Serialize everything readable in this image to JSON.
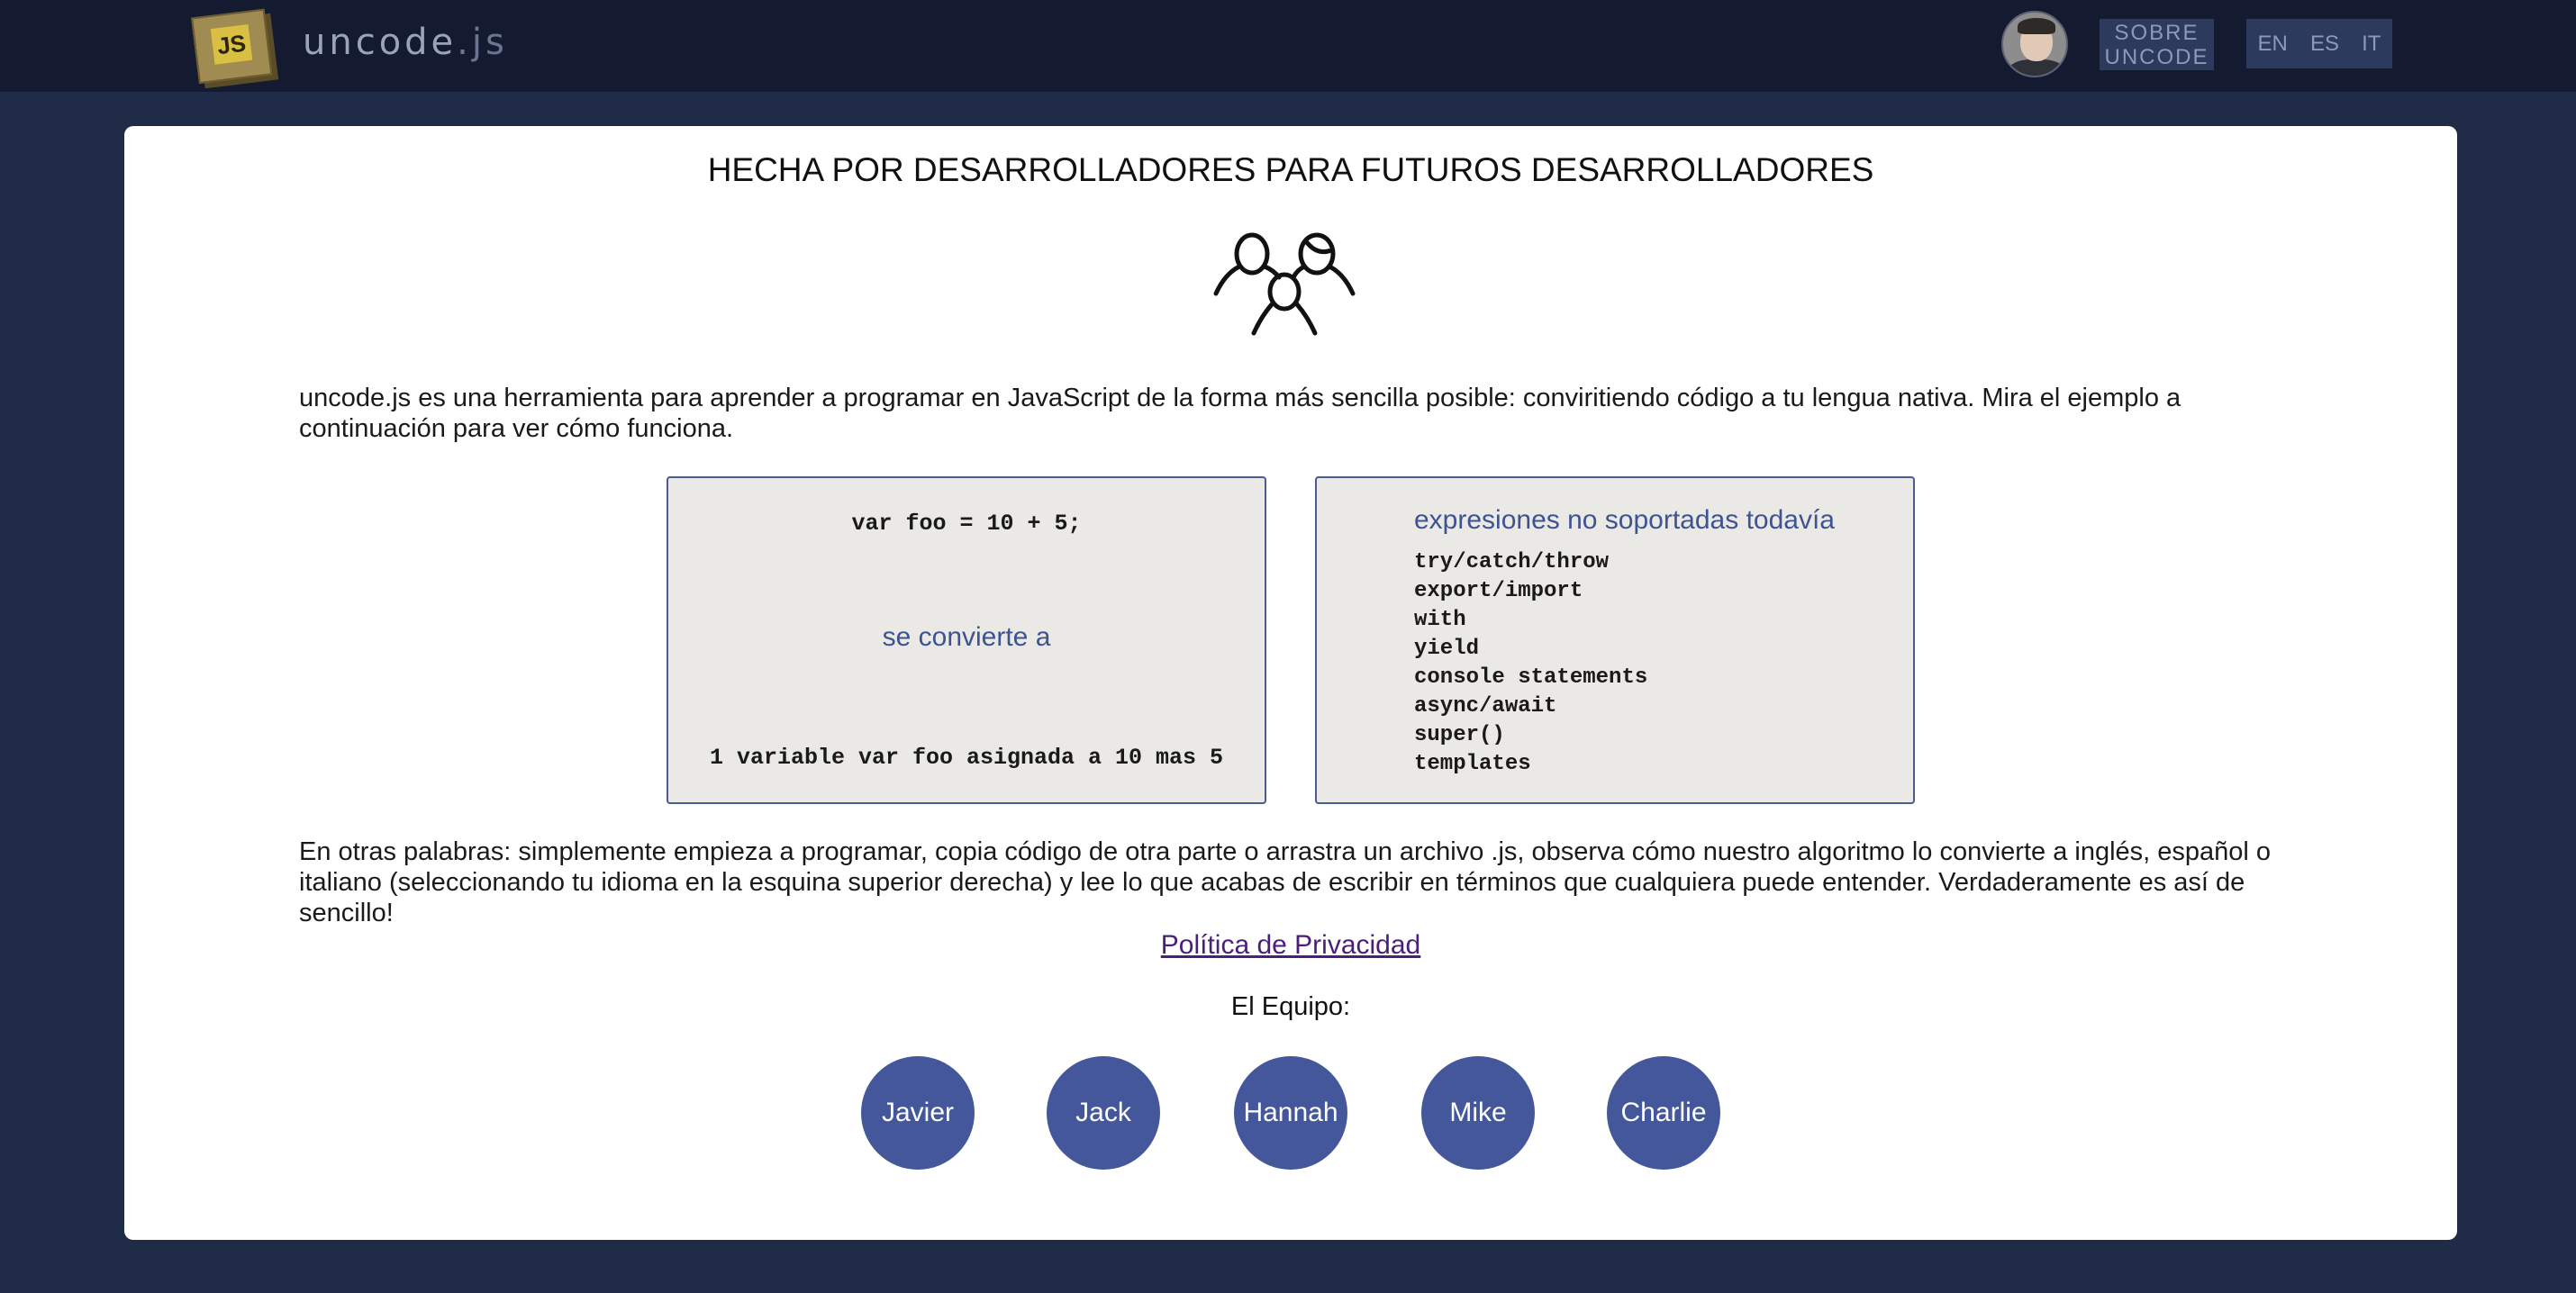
{
  "header": {
    "logo_text": "JS",
    "brand_name": "uncode",
    "brand_ext": ".js",
    "about_button": [
      "SOBRE",
      "UNCODE"
    ],
    "languages": [
      "EN",
      "ES",
      "IT"
    ]
  },
  "main": {
    "title": "HECHA POR DESARROLLADORES PARA FUTUROS DESARROLLADORES",
    "intro": "uncode.js es una herramienta para aprender a programar en JavaScript de la forma más sencilla posible: conviritiendo código a tu lengua nativa. Mira el ejemplo a continuación para ver cómo funciona.",
    "example": {
      "code_in": "var foo = 10 + 5;",
      "converts_label": "se convierte a",
      "code_out": "1 variable var foo asignada a 10 mas 5"
    },
    "unsupported": {
      "title": "expresiones no soportadas todavía",
      "items": [
        "try/catch/throw",
        "export/import",
        "with",
        "yield",
        "console statements",
        "async/await",
        "super()",
        "templates"
      ]
    },
    "outro": "En otras palabras: simplemente empieza a programar, copia código de otra parte o arrastra un archivo .js, observa cómo nuestro algoritmo lo convierte a inglés, español o italiano (seleccionando tu idioma en la esquina superior derecha) y lee lo que acabas de escribir en términos que cualquiera puede entender. Verdaderamente es así de sencillo!",
    "privacy_link": "Política de Privacidad",
    "team_label": "El Equipo:",
    "team": [
      "Javier",
      "Jack",
      "Hannah",
      "Mike",
      "Charlie"
    ]
  },
  "colors": {
    "topbar_bg": "#141b30",
    "page_bg": "#1f2b47",
    "accent": "#3e5391",
    "team_circle": "#43579a",
    "box_bg": "#ebe9e6"
  }
}
